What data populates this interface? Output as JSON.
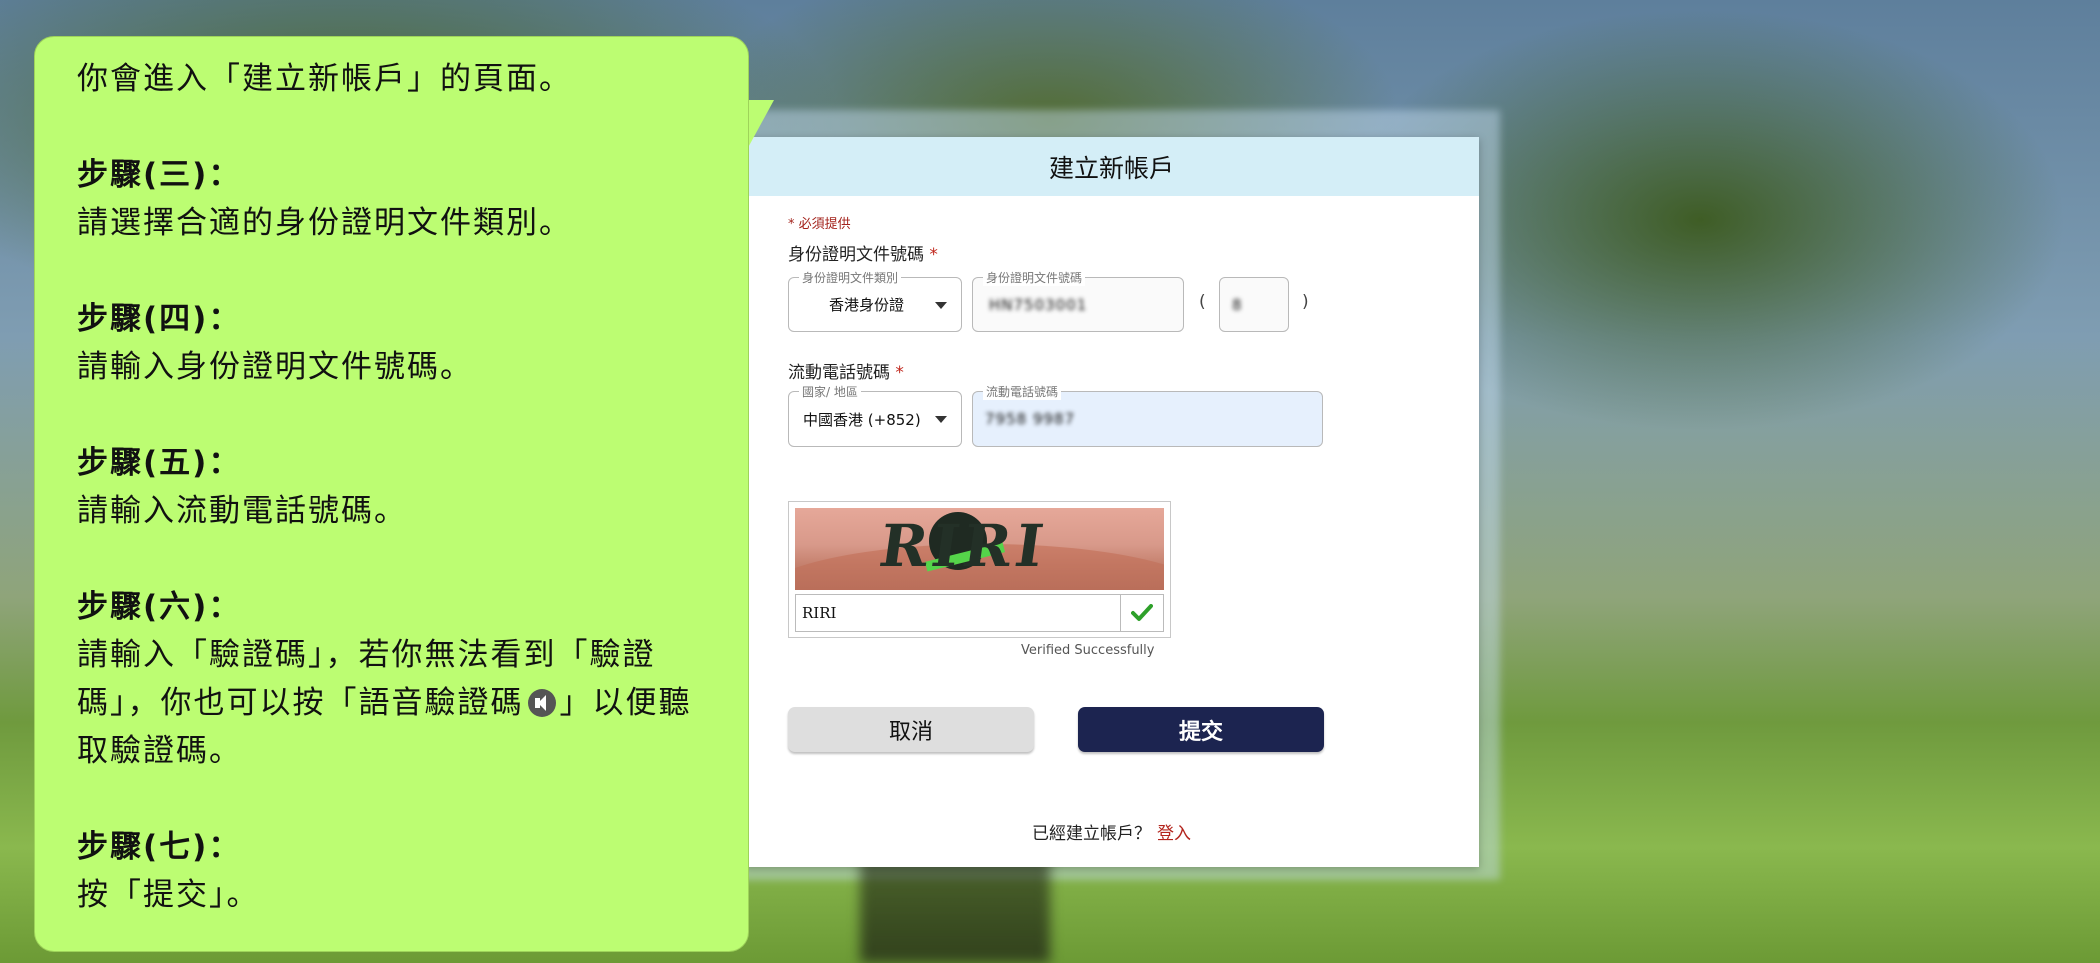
{
  "form": {
    "title": "建立新帳戶",
    "required_note": "* 必須提供",
    "id_section": {
      "label": "身份證明文件號碼",
      "star": "*",
      "doc_type": {
        "legend": "身份證明文件類別",
        "value": "香港身份證"
      },
      "doc_number": {
        "legend": "身份證明文件號碼",
        "value": "HN7503001"
      },
      "check_digit": {
        "value": "8"
      },
      "paren_open": "(",
      "paren_close": ")"
    },
    "phone_section": {
      "label": "流動電話號碼",
      "star": "*",
      "country": {
        "legend": "國家/ 地區",
        "value": "中國香港 (+852)"
      },
      "phone": {
        "legend": "流動電話號碼",
        "value": "7958 9987"
      }
    },
    "captcha": {
      "image_text": "RIRI",
      "input_value": "RIRI",
      "status": "Verified Successfully"
    },
    "buttons": {
      "cancel": "取消",
      "submit": "提交"
    },
    "login": {
      "prompt": "已經建立帳戶？",
      "link": "登入"
    }
  },
  "instructions": {
    "intro": "你會進入「建立新帳戶」的頁面。",
    "steps": [
      {
        "title": "步驟(三)：",
        "text": "請選擇合適的身份證明文件類別。"
      },
      {
        "title": "步驟(四)：",
        "text": "請輸入身份證明文件號碼。"
      },
      {
        "title": "步驟(五)：",
        "text": "請輸入流動電話號碼。"
      },
      {
        "title": "步驟(六)：",
        "text_a": "請輸入「驗證碼」，若你無法看到「驗證碼」，你也可以按「語音驗證碼",
        "text_b": "」以便聽取驗證碼。"
      },
      {
        "title": "步驟(七)：",
        "text": "按「提交」。"
      }
    ]
  },
  "colors": {
    "bubble": "#bcfd72",
    "header": "#d4eef7",
    "submit": "#1c2450",
    "required": "#c0271d",
    "verified_check": "#2ea02a"
  }
}
